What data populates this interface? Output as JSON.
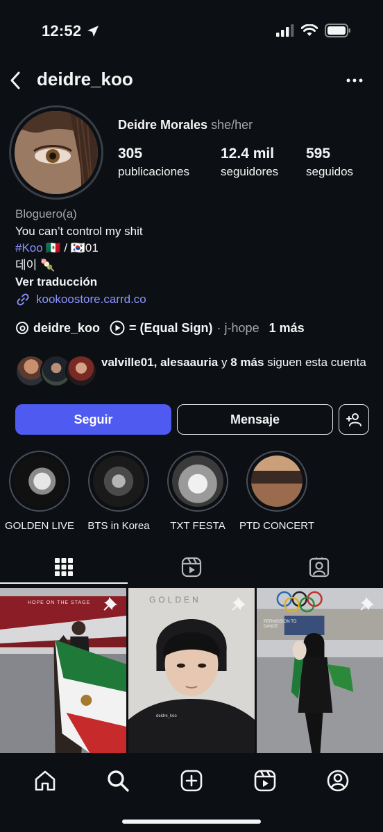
{
  "status": {
    "time": "12:52"
  },
  "header": {
    "username": "deidre_koo"
  },
  "profile": {
    "full_name": "Deidre Morales",
    "pronouns": "she/her",
    "stats": [
      {
        "value": "305",
        "label": "publicaciones"
      },
      {
        "value": "12.4 mil",
        "label": "seguidores"
      },
      {
        "value": "595",
        "label": "seguidos"
      }
    ]
  },
  "bio": {
    "category": "Bloguero(a)",
    "line1": "You can’t control my shit",
    "hashtag": "#Koo",
    "line2_rest": " 🇲🇽 / 🇰🇷01",
    "line3": "데이 🍡",
    "translate": "Ver traducción",
    "link": "kookoostore.carrd.co"
  },
  "chips": {
    "threads_handle": "deidre_koo",
    "music_title": "= (Equal Sign)",
    "music_artist": "· j-hope",
    "more": "1 más"
  },
  "followed_by": {
    "names": "valville01, alesaauria",
    "conj": " y ",
    "more": "8 más",
    "suffix": " siguen esta cuenta"
  },
  "actions": {
    "follow": "Seguir",
    "message": "Mensaje"
  },
  "highlights": [
    {
      "label": "GOLDEN LIVE"
    },
    {
      "label": "BTS in Korea"
    },
    {
      "label": "TXT FESTA"
    },
    {
      "label": "PTD CONCERT"
    }
  ],
  "tabs": [
    {
      "icon": "grid-icon"
    },
    {
      "icon": "reels-icon"
    },
    {
      "icon": "tagged-icon"
    }
  ],
  "posts": [
    {
      "caption": "HOPE ON THE STAGE"
    },
    {
      "caption": "GOLDEN",
      "watermark": "deidre_koo"
    },
    {
      "caption": "PERMISSION TO DANCE"
    }
  ],
  "bottom_nav": [
    "home-icon",
    "search-icon",
    "create-icon",
    "reels-icon",
    "profile-icon"
  ]
}
